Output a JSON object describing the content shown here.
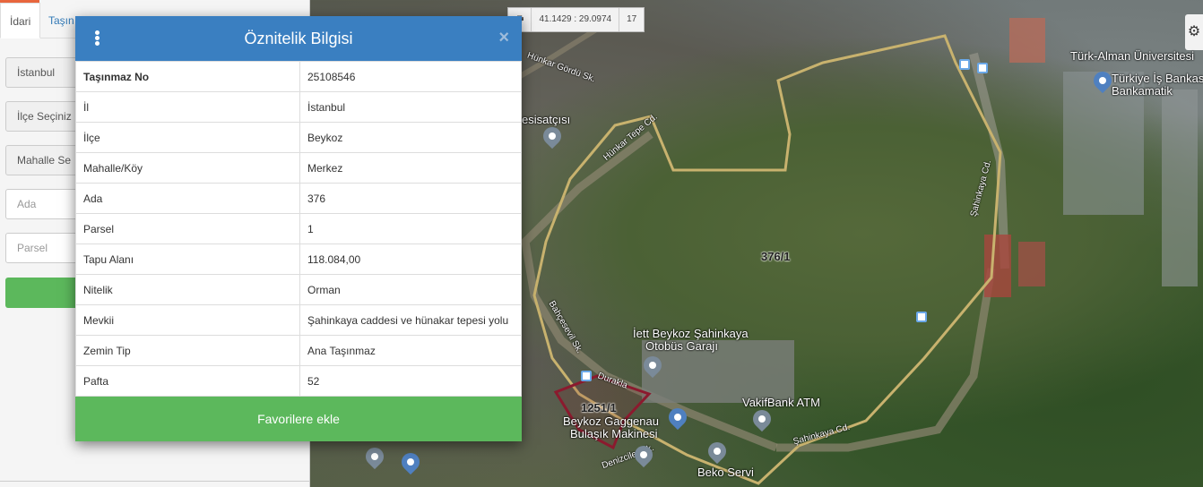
{
  "left_panel": {
    "tabs": [
      {
        "label": "İdari",
        "active": true
      },
      {
        "label": "Taşın",
        "active": false
      }
    ],
    "fields": {
      "province": "İstanbul",
      "district": "İlçe Seçiniz",
      "neighborhood": "Mahalle Se",
      "block_placeholder": "Ada",
      "parcel_placeholder": "Parsel"
    }
  },
  "map": {
    "toolbar": {
      "coords": "41.1429 : 29.0974",
      "zoom": "17"
    },
    "labels": {
      "parcel_main": "376/1",
      "parcel_small": "1251/1",
      "university": "Türk-Alman Üniversitesi",
      "bank_line1": "Türkiye İş Bankası",
      "bank_line2": "Bankamatik",
      "garage_line1": "İett Beykoz Şahinkaya",
      "garage_line2": "Otobüs Garajı",
      "vakifbank": "VakifBank ATM",
      "gaggenau_line1": "Beykoz Gaggenau",
      "gaggenau_line2": "Bulaşık Makinesi",
      "beko": "Beko Servi",
      "satici": "esisatçısı",
      "street_hunkar_gordu": "Hünkar Gördü Sk.",
      "street_hunkar_tepe": "Hünkar Tepe Cd.",
      "street_sahinkaya_top": "Şahinkaya Cd.",
      "street_sahinkaya_bottom": "Şahinkaya Cd.",
      "street_bahcesevil": "Bahçesevil Sk.",
      "street_duraklar": "Durakla",
      "street_denizciler": "Denizciler Sk."
    }
  },
  "modal": {
    "title": "Öznitelik Bilgisi",
    "close": "×",
    "rows": [
      {
        "key": "Taşınmaz No",
        "value": "25108546"
      },
      {
        "key": "İl",
        "value": "İstanbul"
      },
      {
        "key": "İlçe",
        "value": "Beykoz"
      },
      {
        "key": "Mahalle/Köy",
        "value": "Merkez"
      },
      {
        "key": "Ada",
        "value": "376"
      },
      {
        "key": "Parsel",
        "value": "1"
      },
      {
        "key": "Tapu Alanı",
        "value": "118.084,00"
      },
      {
        "key": "Nitelik",
        "value": "Orman"
      },
      {
        "key": "Mevkii",
        "value": "Şahinkaya caddesi ve hünakar tepesi yolu"
      },
      {
        "key": "Zemin Tip",
        "value": "Ana Taşınmaz"
      },
      {
        "key": "Pafta",
        "value": "52"
      }
    ],
    "favorite_button": "Favorilere ekle"
  },
  "colors": {
    "header_blue": "#3a7fc1",
    "success_green": "#5cb85c",
    "parcel_outline": "#c8b26e",
    "selected_parcel": "#8b1a2e"
  },
  "icons": [
    "menu-icon",
    "close-icon",
    "print-icon",
    "gear-icon",
    "map-pin-icon",
    "bus-stop-icon"
  ]
}
